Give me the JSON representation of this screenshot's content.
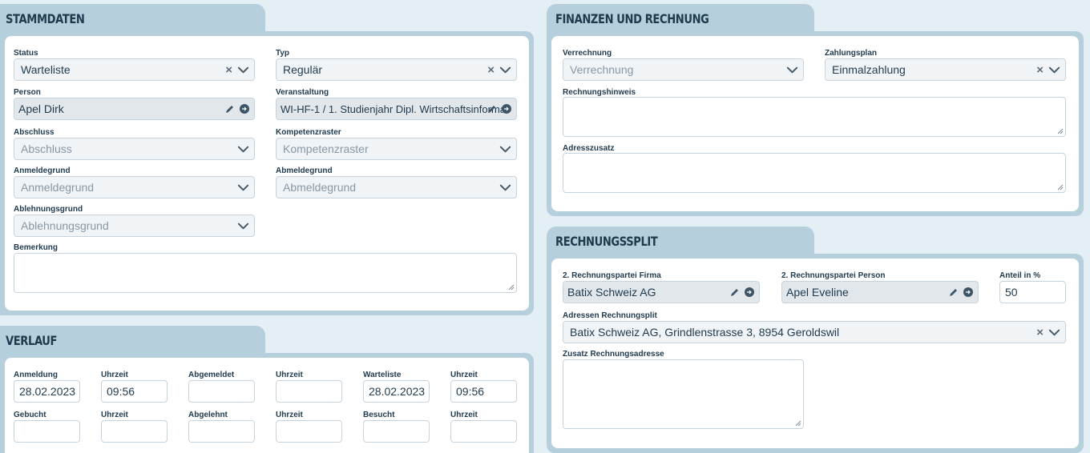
{
  "stammdaten": {
    "title": "Stammdaten",
    "status": {
      "label": "Status",
      "value": "Warteliste"
    },
    "typ": {
      "label": "Typ",
      "value": "Regulär"
    },
    "person": {
      "label": "Person",
      "value": "Apel Dirk"
    },
    "veranstaltung": {
      "label": "Veranstaltung",
      "value": "WI-HF-1 / 1. Studienjahr Dipl. Wirtschaftsinforma"
    },
    "abschluss": {
      "label": "Abschluss",
      "placeholder": "Abschluss"
    },
    "kompetenzraster": {
      "label": "Kompetenzraster",
      "placeholder": "Kompetenzraster"
    },
    "anmeldegrund": {
      "label": "Anmeldegrund",
      "placeholder": "Anmeldegrund"
    },
    "abmeldegrund": {
      "label": "Abmeldegrund",
      "placeholder": "Abmeldegrund"
    },
    "ablehnungsgrund": {
      "label": "Ablehnungsgrund",
      "placeholder": "Ablehnungsgrund"
    },
    "bemerkung": {
      "label": "Bemerkung"
    }
  },
  "verlauf": {
    "title": "Verlauf",
    "row1": [
      {
        "label": "Anmeldung",
        "value": "28.02.2023"
      },
      {
        "label": "Uhrzeit",
        "value": "09:56"
      },
      {
        "label": "Abgemeldet",
        "value": ""
      },
      {
        "label": "Uhrzeit",
        "value": ""
      },
      {
        "label": "Warteliste",
        "value": "28.02.2023"
      },
      {
        "label": "Uhrzeit",
        "value": "09:56"
      }
    ],
    "row2": [
      {
        "label": "Gebucht",
        "value": ""
      },
      {
        "label": "Uhrzeit",
        "value": ""
      },
      {
        "label": "Abgelehnt",
        "value": ""
      },
      {
        "label": "Uhrzeit",
        "value": ""
      },
      {
        "label": "Besucht",
        "value": ""
      },
      {
        "label": "Uhrzeit",
        "value": ""
      }
    ]
  },
  "finanzen": {
    "title": "Finanzen und Rechnung",
    "verrechnung": {
      "label": "Verrechnung",
      "placeholder": "Verrechnung"
    },
    "zahlungsplan": {
      "label": "Zahlungsplan",
      "value": "Einmalzahlung"
    },
    "rechnungshinweis": {
      "label": "Rechnungshinweis"
    },
    "adresszusatz": {
      "label": "Adresszusatz"
    }
  },
  "rechnungssplit": {
    "title": "Rechnungssplit",
    "firma": {
      "label": "2. Rechnungspartei Firma",
      "value": "Batix Schweiz AG"
    },
    "person": {
      "label": "2. Rechnungspartei Person",
      "value": "Apel Eveline"
    },
    "anteil": {
      "label": "Anteil in %",
      "value": "50"
    },
    "adressen": {
      "label": "Adressen Rechnungsplit",
      "value": "Batix Schweiz AG, Grindlenstrasse 3, 8954 Geroldswil"
    },
    "zusatz": {
      "label": "Zusatz Rechnungsadresse"
    }
  },
  "colors": {
    "panel": "#b6cfdc",
    "background": "#e4eef5",
    "text": "#1f3a4d"
  }
}
